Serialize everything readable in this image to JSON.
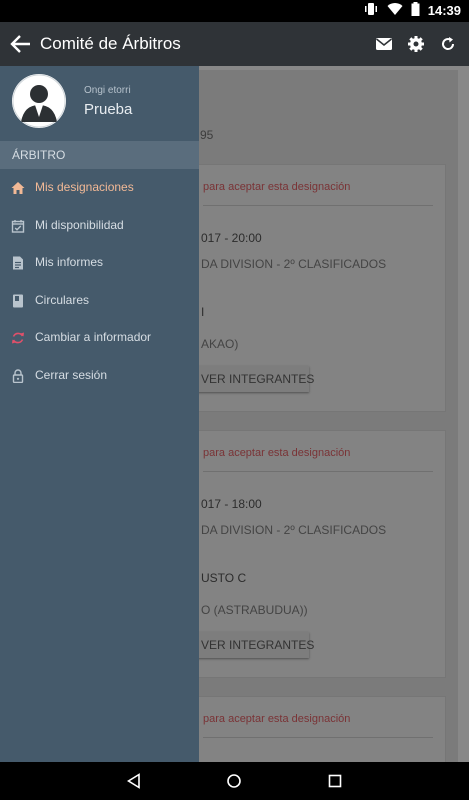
{
  "status_bar": {
    "time": "14:39"
  },
  "app_bar": {
    "title": "Comité de Árbitros"
  },
  "background": {
    "ref_fragment": "95",
    "cards": [
      {
        "warn": "para aceptar esta designación",
        "datetime": "017 - 20:00",
        "category": "DA DIVISION - 2º CLASIFICADOS",
        "team": "I",
        "venue": "AKAO)",
        "button": "VER INTEGRANTES"
      },
      {
        "warn": "para aceptar esta designación",
        "datetime": "017 - 18:00",
        "category": "DA DIVISION - 2º CLASIFICADOS",
        "team": "USTO C",
        "venue": "O (ASTRABUDUA))",
        "button": "VER INTEGRANTES"
      },
      {
        "warn": "para aceptar esta designación"
      }
    ]
  },
  "drawer": {
    "greeting": "Ongi etorri",
    "username": "Prueba",
    "section": "ÁRBITRO",
    "items": [
      {
        "label": "Mis designaciones",
        "icon": "home-icon",
        "active": true
      },
      {
        "label": "Mi disponibilidad",
        "icon": "calendar-check-icon"
      },
      {
        "label": "Mis informes",
        "icon": "document-icon"
      },
      {
        "label": "Circulares",
        "icon": "book-icon"
      },
      {
        "label": "Cambiar a informador",
        "icon": "sync-icon"
      },
      {
        "label": "Cerrar sesión",
        "icon": "lock-icon"
      }
    ],
    "colors": {
      "background": "#455a6b",
      "accent": "#f2b996",
      "sync": "#e0506a"
    }
  }
}
